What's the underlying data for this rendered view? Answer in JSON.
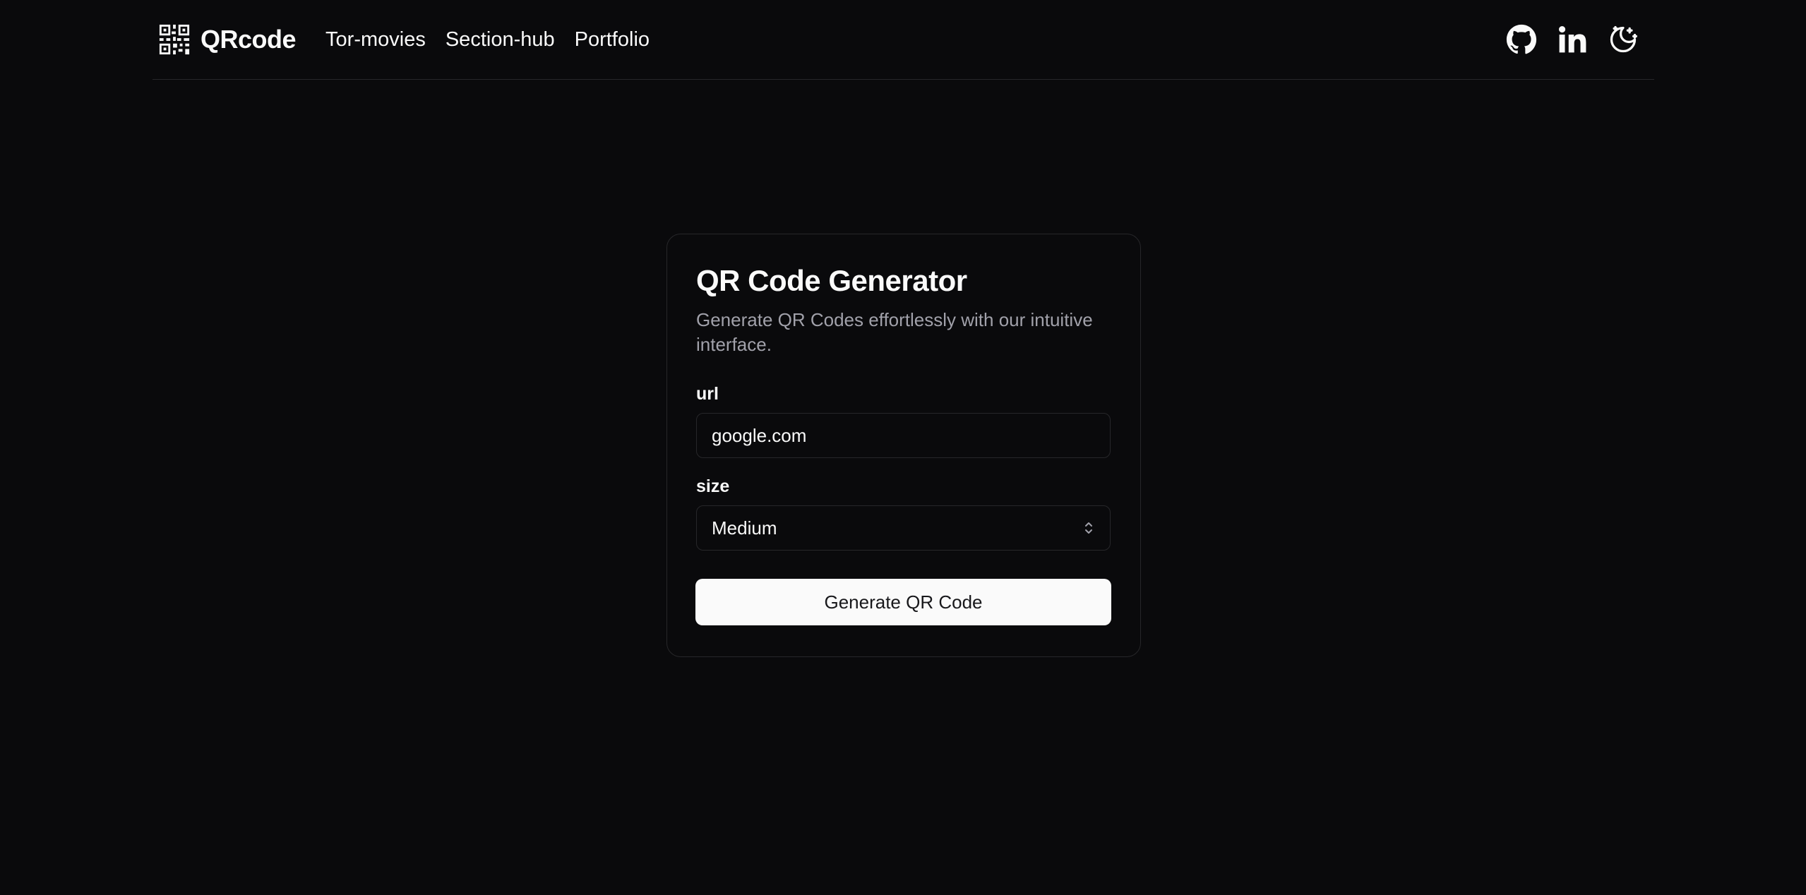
{
  "header": {
    "brand": {
      "name": "QRcode",
      "icon": "qr-code-icon"
    },
    "nav": [
      {
        "label": "Tor-movies"
      },
      {
        "label": "Section-hub"
      },
      {
        "label": "Portfolio"
      }
    ],
    "actions": [
      {
        "icon": "github-icon"
      },
      {
        "icon": "linkedin-icon"
      },
      {
        "icon": "moon-stars-icon"
      }
    ]
  },
  "card": {
    "title": "QR Code Generator",
    "description": "Generate QR Codes effortlessly with our intuitive interface.",
    "url_field": {
      "label": "url",
      "value": "google.com"
    },
    "size_field": {
      "label": "size",
      "selected": "Medium",
      "icon": "chevron-up-down-icon"
    },
    "submit_label": "Generate QR Code"
  },
  "colors": {
    "background": "#0a0a0c",
    "border": "#27272a",
    "text": "#fafafa",
    "muted_text": "#a1a1aa",
    "button_bg": "#fafafa",
    "button_text": "#18181b"
  }
}
